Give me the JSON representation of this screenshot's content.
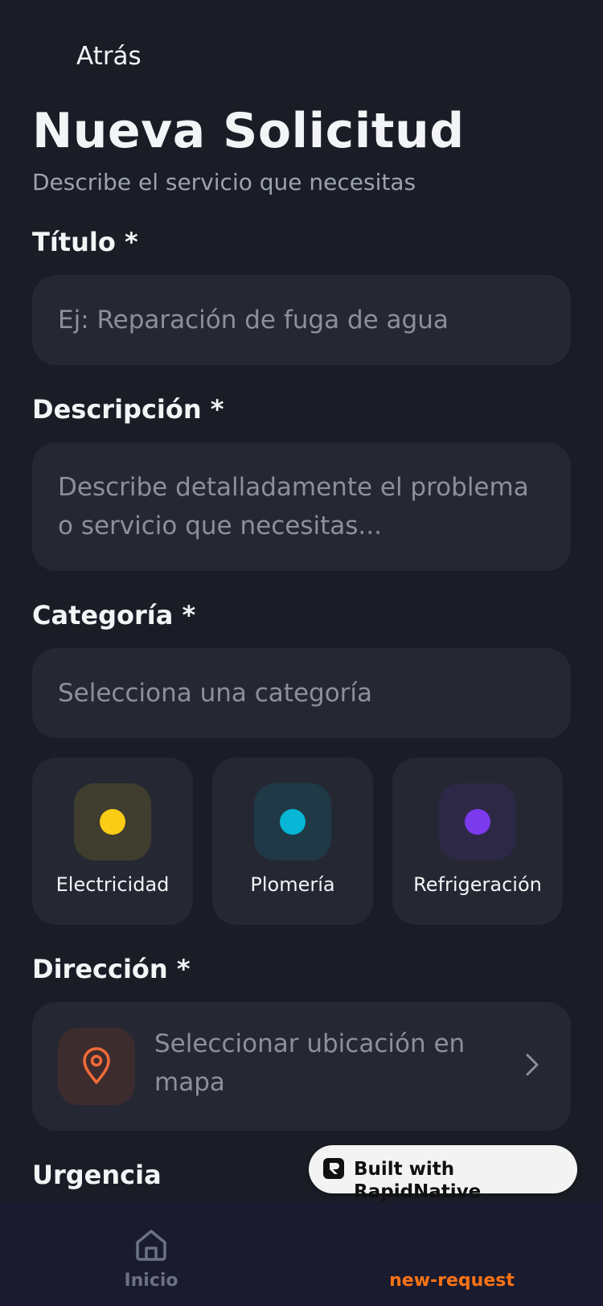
{
  "header": {
    "back_label": "Atrás",
    "title": "Nueva Solicitud",
    "subtitle": "Describe el servicio que necesitas"
  },
  "form": {
    "title_label": "Título *",
    "title_placeholder": "Ej: Reparación de fuga de agua",
    "description_label": "Descripción *",
    "description_placeholder": "Describe detalladamente el problema o servicio que necesitas...",
    "category_label": "Categoría *",
    "category_placeholder": "Selecciona una categoría",
    "categories": [
      {
        "name": "Electricidad",
        "color": "#facc15",
        "bg": "#3f3d2e"
      },
      {
        "name": "Plomería",
        "color": "#06b6d4",
        "bg": "#1f3946"
      },
      {
        "name": "Refrigeración",
        "color": "#7c3aed",
        "bg": "#2e2847"
      }
    ],
    "address_label": "Dirección *",
    "address_placeholder": "Seleccionar ubicación en mapa",
    "urgency_label": "Urgencia"
  },
  "badge": {
    "label": "Built with RapidNative"
  },
  "tabbar": {
    "items": [
      {
        "label": "Inicio",
        "icon": "home-icon",
        "color": "#6b7280"
      },
      {
        "label": "new-request",
        "icon": "",
        "color": "#f97316"
      }
    ]
  },
  "colors": {
    "background": "#1a1d26",
    "card": "#252833",
    "accent": "#f97316"
  }
}
